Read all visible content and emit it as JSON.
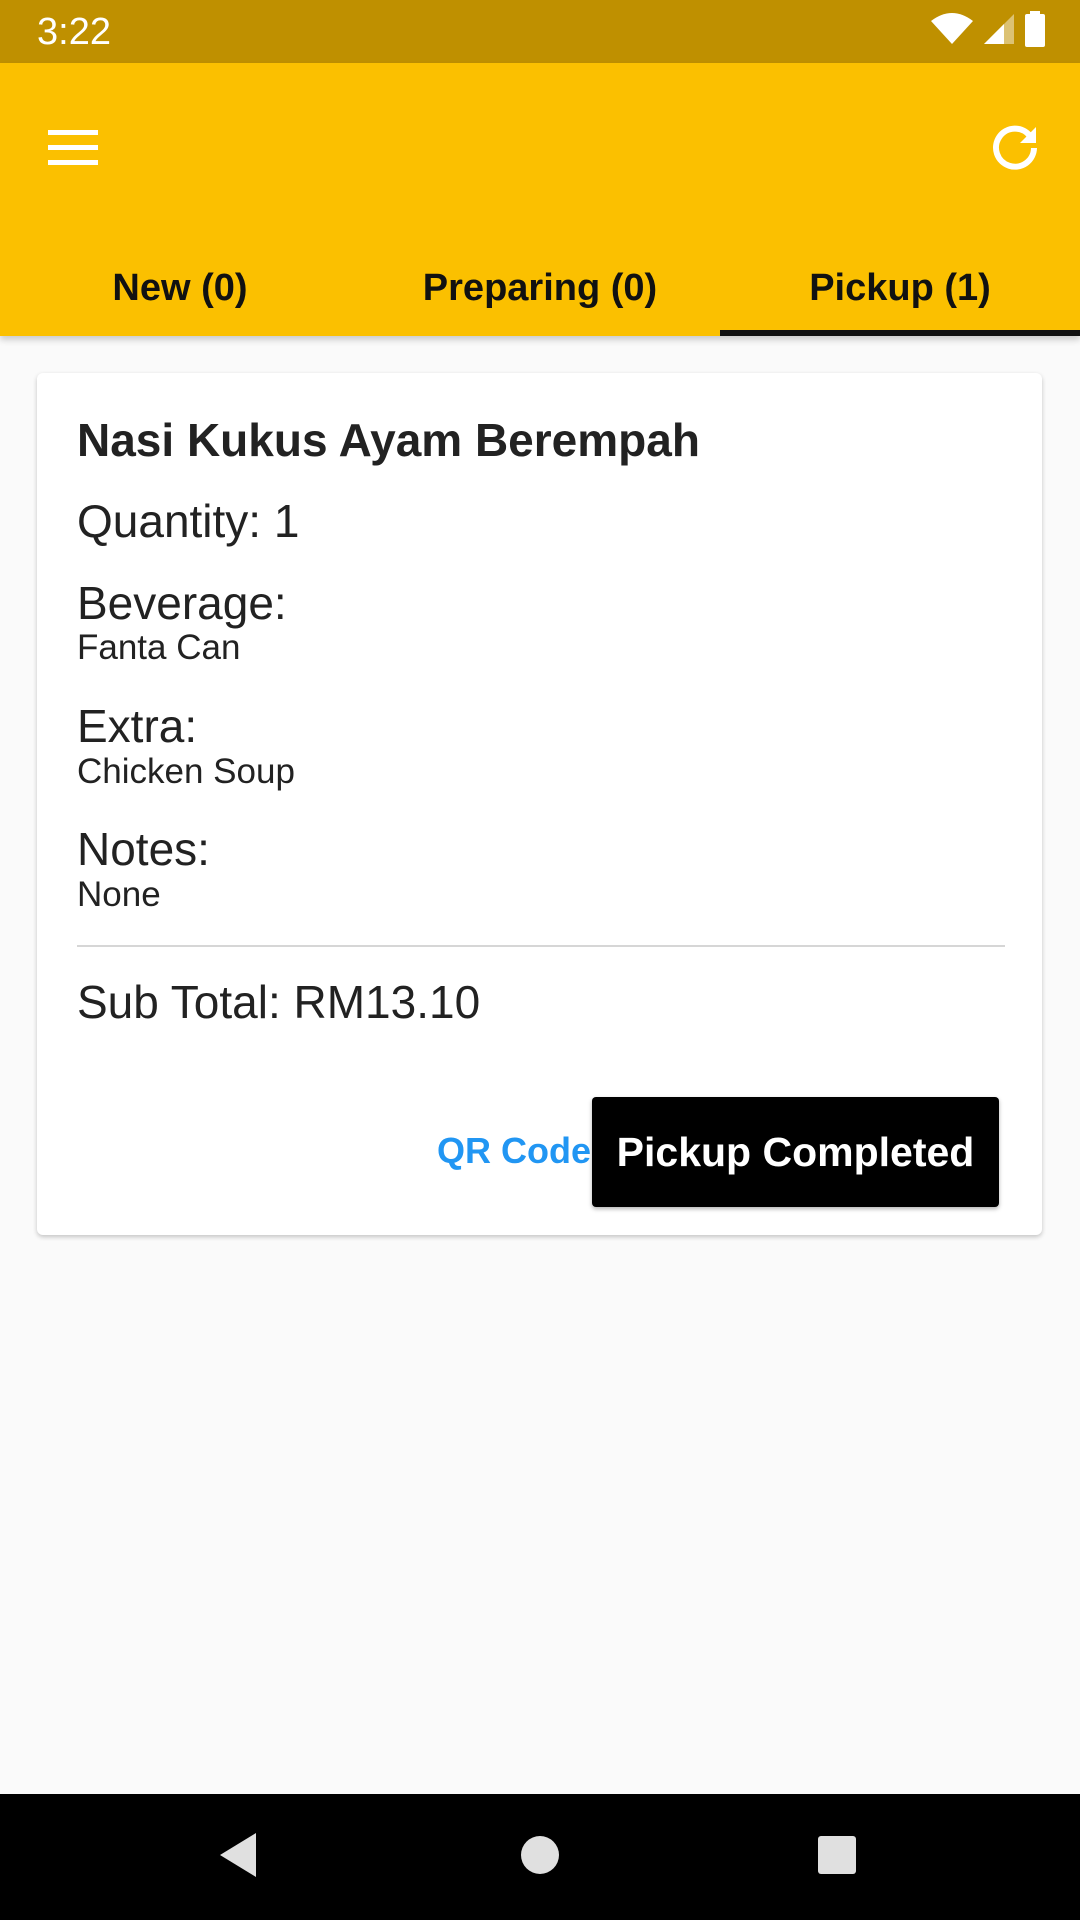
{
  "status_bar": {
    "time": "3:22",
    "icons": [
      "wifi-icon",
      "signal-icon",
      "battery-icon"
    ]
  },
  "app_bar": {
    "menu_icon": "menu-icon",
    "refresh_icon": "refresh-icon",
    "background_color": "#fbc000"
  },
  "tabs": [
    {
      "label": "New (0)",
      "active": false
    },
    {
      "label": "Preparing (0)",
      "active": false
    },
    {
      "label": "Pickup (1)",
      "active": true
    }
  ],
  "order": {
    "item_name": "Nasi Kukus Ayam Berempah",
    "quantity": "Quantity: 1",
    "beverage_label": "Beverage:",
    "beverage_value": "Fanta Can",
    "extra_label": "Extra:",
    "extra_value": "Chicken Soup",
    "notes_label": "Notes:",
    "notes_value": "None",
    "subtotal": "Sub Total: RM13.10",
    "qr_button_label": "QR Code",
    "complete_button_label": "Pickup Completed"
  },
  "nav_bar": {
    "icons": [
      "back-icon",
      "home-icon",
      "recents-icon"
    ]
  },
  "colors": {
    "status_bar": "#bf9000",
    "accent": "#fbc000",
    "link": "#2196f3",
    "primary_button": "#000000"
  }
}
